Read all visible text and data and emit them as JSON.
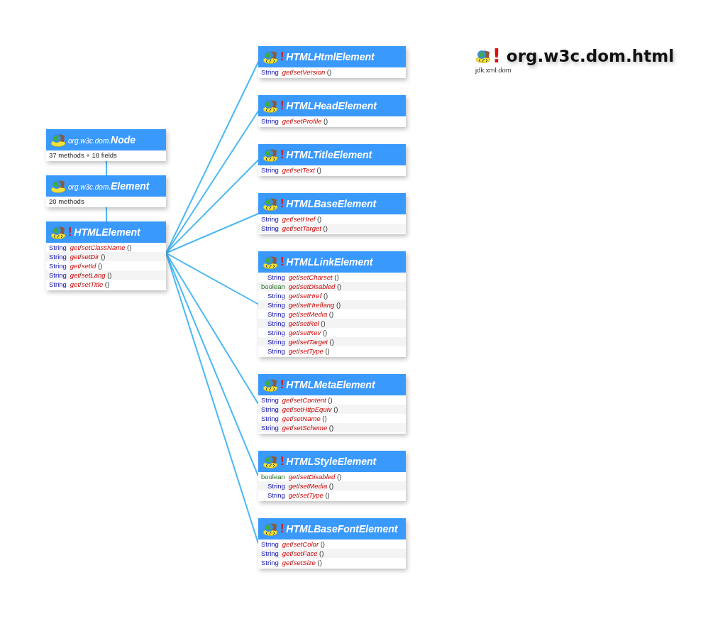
{
  "package": {
    "icon_marker": "!",
    "title": "org.w3c.dom.html",
    "module": "jdk.xml.dom"
  },
  "hierarchy": [
    {
      "prefix": "org.w3c.dom.",
      "name": "Node",
      "summary": "37 methods + 18 fields"
    },
    {
      "prefix": "org.w3c.dom.",
      "name": "Element",
      "summary": "20 methods"
    },
    {
      "marker": "!",
      "name": "HTMLElement",
      "members": [
        {
          "type": "String",
          "kind": "class",
          "method": [
            "get",
            "/",
            "setClassName"
          ],
          "args": "()"
        },
        {
          "type": "String",
          "kind": "class",
          "method": [
            "get",
            "/",
            "setDir"
          ],
          "args": "()"
        },
        {
          "type": "String",
          "kind": "class",
          "method": [
            "get",
            "/",
            "setId"
          ],
          "args": "()"
        },
        {
          "type": "String",
          "kind": "class",
          "method": [
            "get",
            "/",
            "setLang"
          ],
          "args": "()"
        },
        {
          "type": "String",
          "kind": "class",
          "method": [
            "get",
            "/",
            "setTitle"
          ],
          "args": "()"
        }
      ]
    }
  ],
  "subclasses": [
    {
      "marker": "!",
      "name": "HTMLHtmlElement",
      "members": [
        {
          "type": "String",
          "kind": "class",
          "method": [
            "get",
            "/",
            "setVersion"
          ],
          "args": "()"
        }
      ]
    },
    {
      "marker": "!",
      "name": "HTMLHeadElement",
      "members": [
        {
          "type": "String",
          "kind": "class",
          "method": [
            "get",
            "/",
            "setProfile"
          ],
          "args": "()"
        }
      ]
    },
    {
      "marker": "!",
      "name": "HTMLTitleElement",
      "members": [
        {
          "type": "String",
          "kind": "class",
          "method": [
            "get",
            "/",
            "setText"
          ],
          "args": "()"
        }
      ]
    },
    {
      "marker": "!",
      "name": "HTMLBaseElement",
      "members": [
        {
          "type": "String",
          "kind": "class",
          "method": [
            "get",
            "/",
            "setHref"
          ],
          "args": "()"
        },
        {
          "type": "String",
          "kind": "class",
          "method": [
            "get",
            "/",
            "setTarget"
          ],
          "args": "()"
        }
      ]
    },
    {
      "marker": "!",
      "name": "HTMLLinkElement",
      "members": [
        {
          "type": "String",
          "kind": "class",
          "method": [
            "get",
            "/",
            "setCharset"
          ],
          "args": "()"
        },
        {
          "type": "boolean",
          "kind": "primitive",
          "method": [
            "get",
            "/",
            "setDisabled"
          ],
          "args": "()"
        },
        {
          "type": "String",
          "kind": "class",
          "method": [
            "get",
            "/",
            "setHref"
          ],
          "args": "()"
        },
        {
          "type": "String",
          "kind": "class",
          "method": [
            "get",
            "/",
            "setHreflang"
          ],
          "args": "()"
        },
        {
          "type": "String",
          "kind": "class",
          "method": [
            "get",
            "/",
            "setMedia"
          ],
          "args": "()"
        },
        {
          "type": "String",
          "kind": "class",
          "method": [
            "get",
            "/",
            "setRel"
          ],
          "args": "()"
        },
        {
          "type": "String",
          "kind": "class",
          "method": [
            "get",
            "/",
            "setRev"
          ],
          "args": "()"
        },
        {
          "type": "String",
          "kind": "class",
          "method": [
            "get",
            "/",
            "setTarget"
          ],
          "args": "()"
        },
        {
          "type": "String",
          "kind": "class",
          "method": [
            "get",
            "/",
            "setType"
          ],
          "args": "()"
        }
      ]
    },
    {
      "marker": "!",
      "name": "HTMLMetaElement",
      "members": [
        {
          "type": "String",
          "kind": "class",
          "method": [
            "get",
            "/",
            "setContent"
          ],
          "args": "()"
        },
        {
          "type": "String",
          "kind": "class",
          "method": [
            "get",
            "/",
            "setHttpEquiv"
          ],
          "args": "()"
        },
        {
          "type": "String",
          "kind": "class",
          "method": [
            "get",
            "/",
            "setName"
          ],
          "args": "()"
        },
        {
          "type": "String",
          "kind": "class",
          "method": [
            "get",
            "/",
            "setScheme"
          ],
          "args": "()"
        }
      ]
    },
    {
      "marker": "!",
      "name": "HTMLStyleElement",
      "members": [
        {
          "type": "boolean",
          "kind": "primitive",
          "method": [
            "get",
            "/",
            "setDisabled"
          ],
          "args": "()"
        },
        {
          "type": "String",
          "kind": "class",
          "method": [
            "get",
            "/",
            "setMedia"
          ],
          "args": "()"
        },
        {
          "type": "String",
          "kind": "class",
          "method": [
            "get",
            "/",
            "setType"
          ],
          "args": "()"
        }
      ]
    },
    {
      "marker": "!",
      "name": "HTMLBaseFontElement",
      "members": [
        {
          "type": "String",
          "kind": "class",
          "method": [
            "get",
            "/",
            "setColor"
          ],
          "args": "()"
        },
        {
          "type": "String",
          "kind": "class",
          "method": [
            "get",
            "/",
            "setFace"
          ],
          "args": "()"
        },
        {
          "type": "String",
          "kind": "class",
          "method": [
            "get",
            "/",
            "setSize"
          ],
          "args": "()"
        }
      ]
    }
  ]
}
